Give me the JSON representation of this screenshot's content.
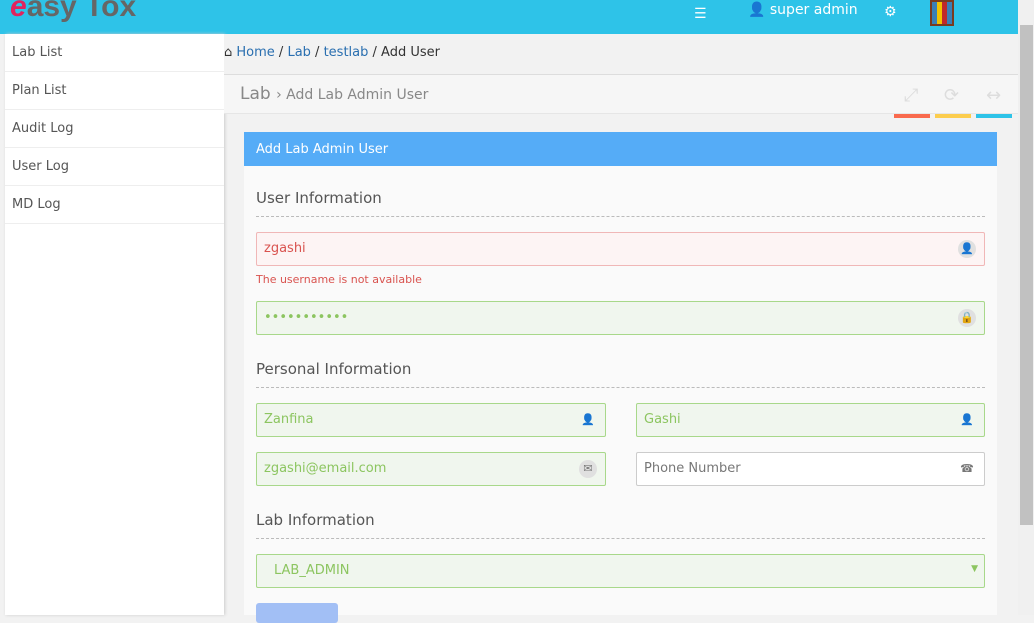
{
  "app": {
    "logo": "EasyTox",
    "user": "super admin"
  },
  "sidebar": {
    "items": [
      {
        "label": "Lab List"
      },
      {
        "label": "Plan List"
      },
      {
        "label": "Audit Log"
      },
      {
        "label": "User Log"
      },
      {
        "label": "MD Log"
      }
    ]
  },
  "breadcrumb": {
    "home": "Home",
    "lab": "Lab",
    "testlab": "testlab",
    "current": "Add User"
  },
  "page": {
    "title": "Lab",
    "subtitle": "Add Lab Admin User"
  },
  "accent_colors": [
    "#f96a4e",
    "#fccd4e",
    "#2ec3e8"
  ],
  "form": {
    "panel_title": "Add Lab Admin User",
    "user_section": "User Information",
    "username": "zgashi",
    "username_error": "The username is not available",
    "password": "•••••••••••",
    "personal_section": "Personal Information",
    "first_name": "Zanfina",
    "last_name": "Gashi",
    "email": "zgashi@email.com",
    "phone_placeholder": "Phone Number",
    "lab_section": "Lab Information",
    "role": "LAB_ADMIN"
  }
}
